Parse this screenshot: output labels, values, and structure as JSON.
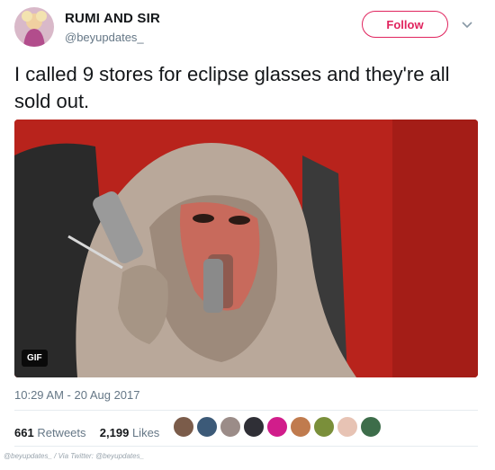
{
  "tweet": {
    "display_name": "RUMI AND SIR",
    "handle": "@beyupdates_",
    "follow_label": "Follow",
    "text": "I called 9 stores for eclipse glasses and they're all sold out.",
    "media_badge": "GIF",
    "timestamp": "10:29 AM - 20 Aug 2017",
    "retweets_count": "661",
    "retweets_label": "Retweets",
    "likes_count": "2,199",
    "likes_label": "Likes",
    "liker_avatar_count": 9
  },
  "footer": {
    "credit": "@beyupdates_ / Via Twitter: @beyupdates_"
  },
  "colors": {
    "follow_accent": "#e0245e",
    "secondary_text": "#657786",
    "media_background": "#b8231c"
  }
}
